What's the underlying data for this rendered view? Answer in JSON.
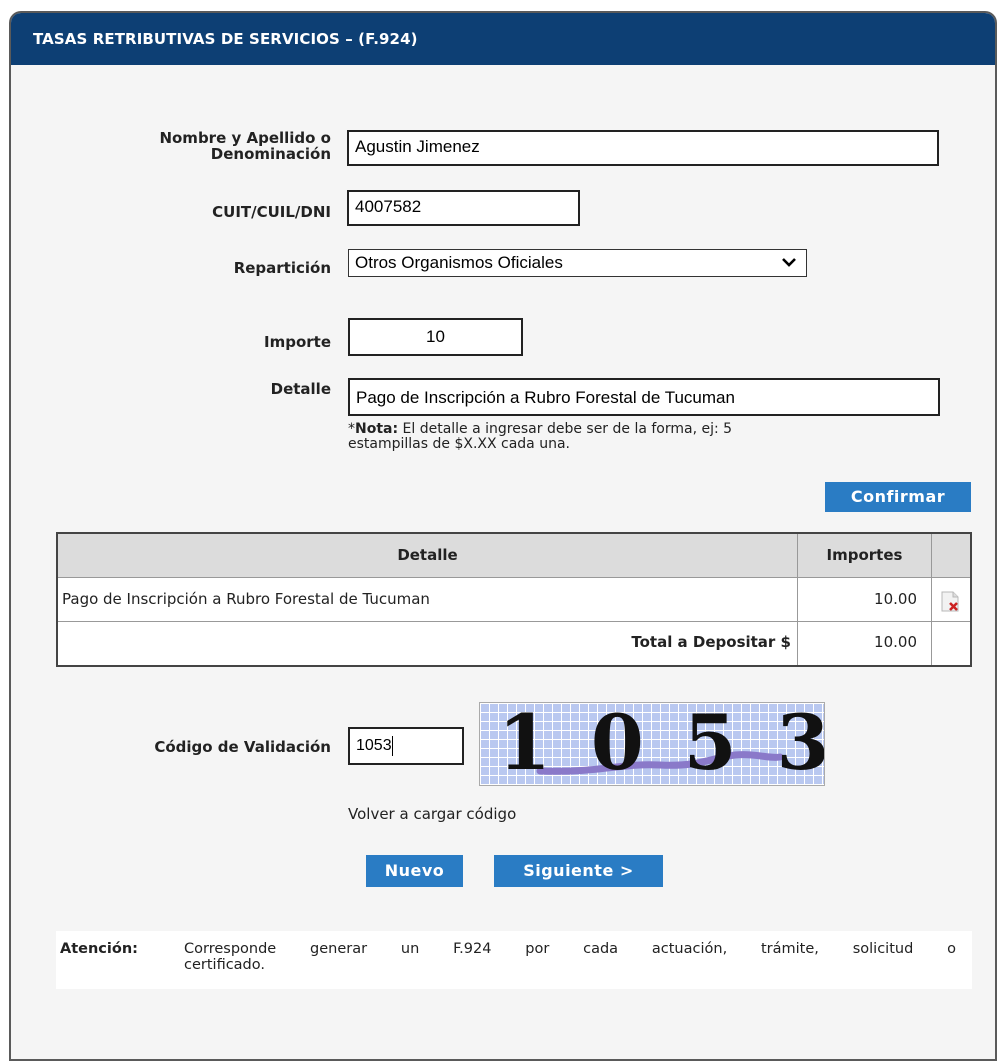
{
  "title": "TASAS RETRIBUTIVAS DE SERVICIOS – (F.924)",
  "form": {
    "nombre_label": "Nombre y Apellido o Denominación",
    "nombre_line1": "Nombre y Apellido o",
    "nombre_line2": "Denominación",
    "nombre_value": "Agustin Jimenez",
    "cuit_label": "CUIT/CUIL/DNI",
    "cuit_value": "4007582",
    "reparticion_label": "Repartición",
    "reparticion_value": "Otros Organismos Oficiales",
    "importe_label": "Importe",
    "importe_value": "10",
    "detalle_label": "Detalle",
    "detalle_value": "Pago de Inscripción a Rubro Forestal de Tucuman",
    "note_bold": "Nota:",
    "note_prefix": "*",
    "note_line1": " El detalle a ingresar debe ser de la forma, ej: 5",
    "note_line2": "estampillas de $X.XX cada una.",
    "confirm_label": "Confirmar"
  },
  "table": {
    "headers": [
      "Detalle",
      "Importes",
      ""
    ],
    "rows": [
      {
        "detalle": "Pago de Inscripción a Rubro Forestal de Tucuman",
        "importe": "10.00",
        "action_icon": "delete-doc-icon"
      }
    ],
    "total_label": "Total a Depositar $",
    "total_value": "10.00"
  },
  "captcha": {
    "label": "Código de Validación",
    "value": "1053",
    "image_text": "1053",
    "reload_label": "Volver a cargar código"
  },
  "buttons": {
    "nuevo": "Nuevo",
    "siguiente": "Siguiente >"
  },
  "attention": {
    "label": "Atención:",
    "text_line1": "Corresponde generar un F.924 por cada actuación, trámite, solicitud o",
    "text_line2": "certificado."
  },
  "colors": {
    "title_bg": "#0d3f74",
    "button_bg": "#2a7cc4",
    "table_header_bg": "#dcdcdc"
  }
}
